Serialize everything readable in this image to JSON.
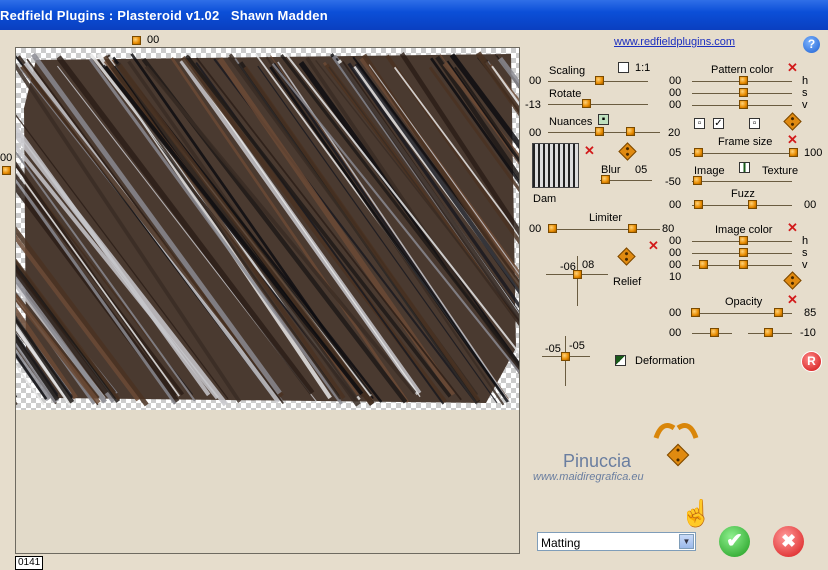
{
  "window": {
    "title": "Redfield Plugins : Plasteroid v1.02   Shawn Madden"
  },
  "top": {
    "preview_offset": "00",
    "left_offset": "00",
    "link": "www.redfieldplugins.com",
    "help": "?"
  },
  "status": {
    "zoom": "0141"
  },
  "controls": {
    "scaling": {
      "label": "Scaling",
      "value": "00",
      "ratio_label": "1:1"
    },
    "rotate": {
      "label": "Rotate",
      "value": "-13"
    },
    "nuances": {
      "label": "Nuances",
      "value_left": "00",
      "value_right": "20"
    },
    "blur": {
      "label": "Blur",
      "value": "05"
    },
    "pattern_thumb_label": "Dam",
    "limiter": {
      "label": "Limiter",
      "value_left": "00",
      "value_right": "80"
    },
    "relief": {
      "label": "Relief",
      "x": "-06",
      "y": "08"
    },
    "deformation": {
      "label": "Deformation",
      "x": "-05",
      "y": "-05"
    },
    "pattern_color": {
      "label": "Pattern color",
      "h": "00",
      "s": "00",
      "v": "00",
      "h_label": "h",
      "s_label": "s",
      "v_label": "v"
    },
    "frame_size": {
      "label": "Frame size",
      "value_left": "05",
      "value_right": "100"
    },
    "image_texture": {
      "image_label": "Image",
      "texture_label": "Texture",
      "value": "-50"
    },
    "fuzz": {
      "label": "Fuzz",
      "value_left": "00",
      "value_right": "00"
    },
    "image_color": {
      "label": "Image color",
      "h": "00",
      "s": "00",
      "v": "00",
      "extra": "10",
      "h_label": "h",
      "s_label": "s",
      "v_label": "v"
    },
    "opacity": {
      "label": "Opacity",
      "value_left": "00",
      "value_right": "85",
      "value2_left": "00",
      "value2_right": "-10"
    }
  },
  "watermark": {
    "name": "Pinuccia",
    "site": "www.maidiregrafica.eu"
  },
  "bottom": {
    "select_value": "Matting",
    "ok_label": "✔",
    "cancel_label": "✖",
    "reset_label": "R"
  }
}
